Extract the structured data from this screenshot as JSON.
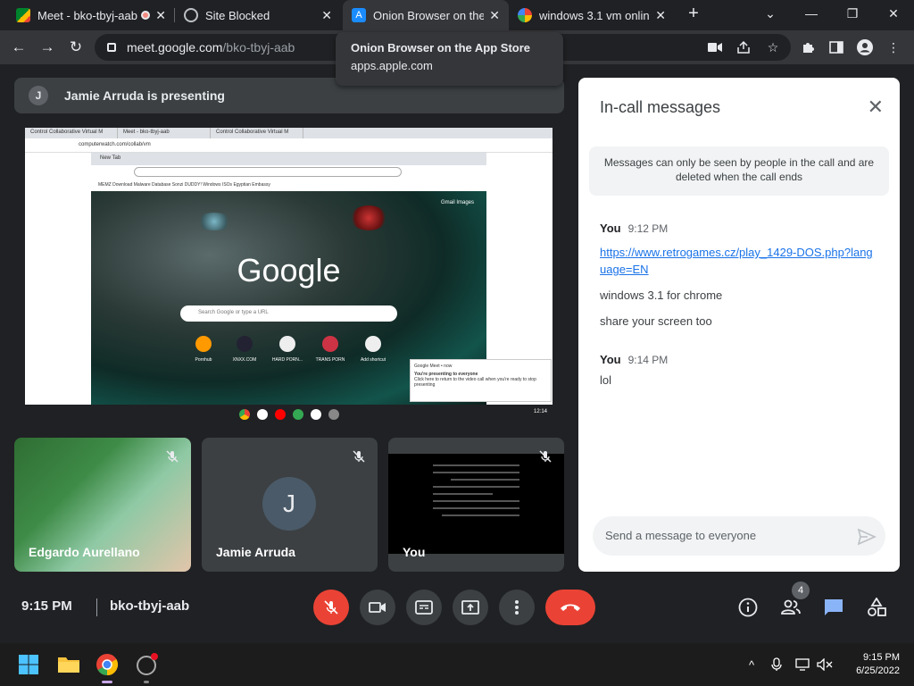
{
  "browser": {
    "tabs": [
      {
        "title": "Meet - bko-tbyj-aab",
        "active": false
      },
      {
        "title": "Site Blocked",
        "active": false
      },
      {
        "title": "Onion Browser on the App Store",
        "active": true
      },
      {
        "title": "windows 3.1 vm online",
        "active": false
      }
    ],
    "new_tab_symbol": "+",
    "url_host": "meet.google.com",
    "url_path": "/bko-tbyj-aab",
    "tooltip": {
      "title": "Onion Browser on the App Store",
      "domain": "apps.apple.com"
    }
  },
  "meet": {
    "presenting_initial": "J",
    "presenting_text": "Jamie Arruda is presenting",
    "shared_screen": {
      "outer_tabs": [
        "Control Collaborative Virtual M",
        "Meet - bko-tbyj-aab",
        "Control Collaborative Virtual M"
      ],
      "outer_url": "computerwatch.com/collab/vm",
      "inner_tab": "New Tab",
      "bookmarks": "MEMZ Download   Malware Database   Sonzi DUDDY!   Windows ISOs   Egyptian Embassy",
      "google_logo": "Google",
      "google_links": "Gmail   Images",
      "search_placeholder": "Search Google or type a URL",
      "shortcuts": [
        "Pornhub",
        "XNXX.COM",
        "HARD PORN...",
        "TRANS PORN",
        "Add shortcut"
      ],
      "notification": {
        "app": "Google Meet • now",
        "line1": "You're presenting to everyone",
        "line2": "Click here to return to the video call when you're ready to stop presenting"
      },
      "shelf_time": "12:14"
    },
    "tiles": [
      {
        "name": "Edgardo Aurellano"
      },
      {
        "name": "Jamie Arruda",
        "initial": "J"
      },
      {
        "name": "You"
      }
    ],
    "time": "9:15 PM",
    "code": "bko-tbyj-aab",
    "participant_count": "4"
  },
  "chat": {
    "title": "In-call messages",
    "info": "Messages can only be seen by people in the call and are deleted when the call ends",
    "messages": [
      {
        "sender": "You",
        "time": "9:12 PM",
        "lines": [
          "https://www.retrogames.cz/play_1429-DOS.php?language=EN",
          "windows 3.1 for chrome",
          "share your screen too"
        ]
      },
      {
        "sender": "You",
        "time": "9:14 PM",
        "lines": [
          "lol"
        ]
      }
    ],
    "input_placeholder": "Send a message to everyone"
  },
  "taskbar": {
    "time": "9:15 PM",
    "date": "6/25/2022"
  },
  "colors": {
    "meet_bg": "#202124",
    "tile_bg": "#3c4043",
    "red": "#ea4335",
    "link": "#1a73e8",
    "chat_active": "#8ab4f8"
  }
}
